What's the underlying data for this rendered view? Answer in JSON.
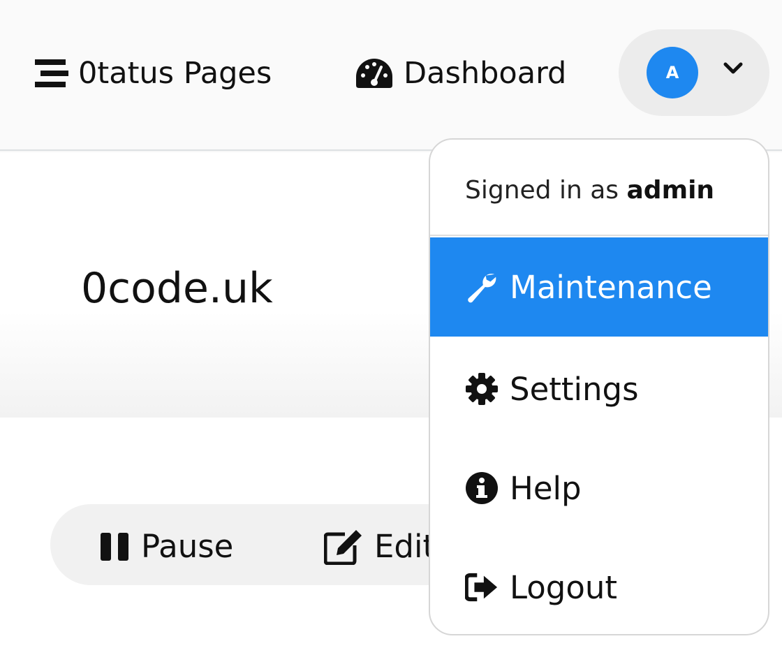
{
  "nav": {
    "status_pages": {
      "label": "0tatus Pages",
      "icon": "stream-icon"
    },
    "dashboard": {
      "label": "Dashboard",
      "icon": "tachometer-icon"
    }
  },
  "profile": {
    "avatar_letter": "A",
    "icon": "chevron-down-icon"
  },
  "monitor": {
    "title": "0code.uk"
  },
  "actions": {
    "pause": {
      "label": "Pause",
      "icon": "pause-icon"
    },
    "edit": {
      "label": "Edit",
      "icon": "edit-icon"
    }
  },
  "dropdown": {
    "signed_prefix": "Signed in as ",
    "username": "admin",
    "items": [
      {
        "label": "Maintenance",
        "icon": "wrench-icon",
        "active": true
      },
      {
        "label": "Settings",
        "icon": "gear-icon",
        "active": false
      },
      {
        "label": "Help",
        "icon": "info-circle-icon",
        "active": false
      },
      {
        "label": "Logout",
        "icon": "logout-icon",
        "active": false
      }
    ]
  },
  "colors": {
    "accent": "#1e88f0",
    "background": "#f8f8f8"
  }
}
